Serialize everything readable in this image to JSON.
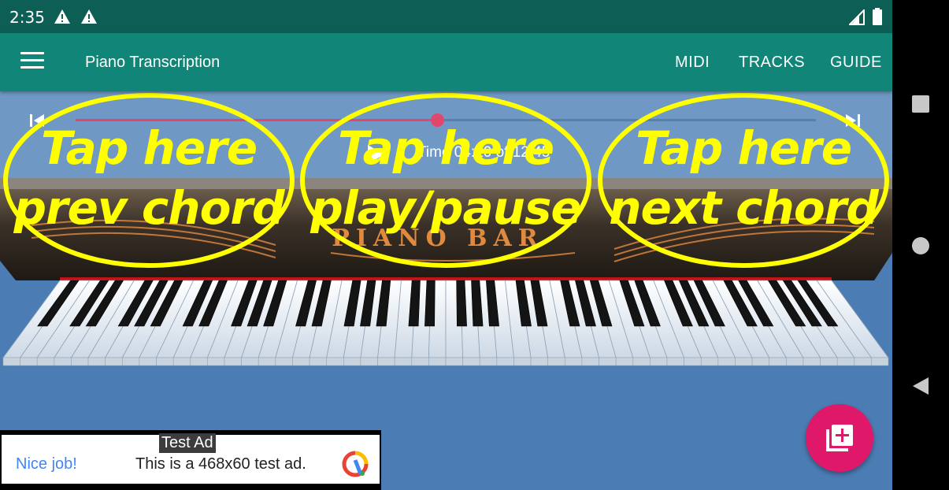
{
  "status_bar": {
    "time": "2:35",
    "icons": [
      "warning-icon",
      "warning-icon",
      "signal-icon",
      "battery-icon"
    ]
  },
  "app_bar": {
    "title": "Piano Transcription",
    "actions": [
      "MIDI",
      "TRACKS",
      "GUIDE"
    ],
    "color": "#118577"
  },
  "player": {
    "time_label": "Time 04:20 of 12:45",
    "progress": 0.488,
    "accent": "#e0476b"
  },
  "overlays": [
    {
      "line1": "Tap here",
      "line2": "prev chord"
    },
    {
      "line1": "Tap here",
      "line2": "play/pause"
    },
    {
      "line1": "Tap here",
      "line2": "next chord"
    }
  ],
  "piano": {
    "logo": "PIANO BAR"
  },
  "ad": {
    "badge": "Test Ad",
    "nice": "Nice job!",
    "text": "This is a 468x60 test ad."
  },
  "fab": {
    "icon": "add-to-library-icon",
    "color": "#e0186a"
  },
  "nav": {
    "icons": [
      "recents-icon",
      "home-icon",
      "back-icon"
    ]
  }
}
